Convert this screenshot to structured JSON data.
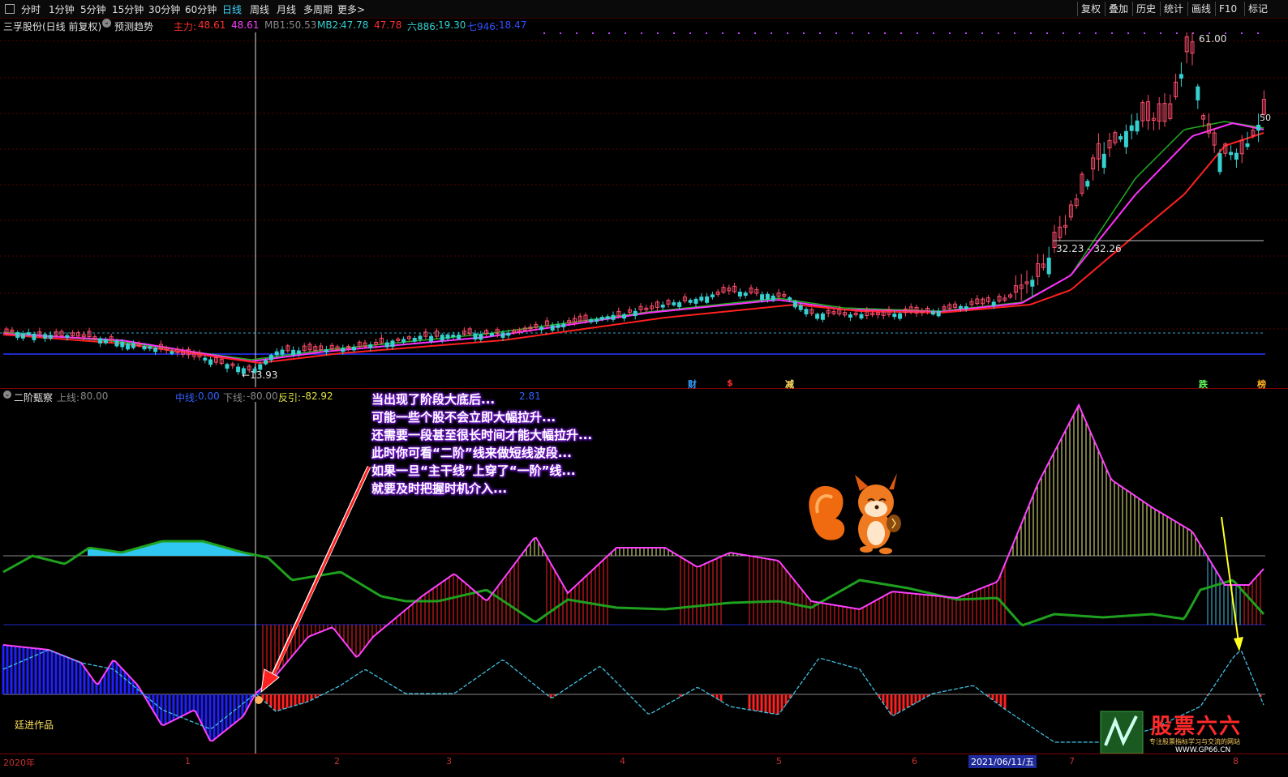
{
  "toolbar": {
    "periods": [
      "分时",
      "1分钟",
      "5分钟",
      "15分钟",
      "30分钟",
      "60分钟",
      "日线",
      "周线",
      "月线",
      "多周期",
      "更多>"
    ],
    "active_period": "日线",
    "right_buttons": [
      "复权",
      "叠加",
      "历史",
      "统计",
      "画线",
      "F10",
      "标记"
    ]
  },
  "main_header": {
    "stock": "三孚股份(日线 前复权)",
    "trend_label": "预测趋势",
    "zhuli_label": "主力:",
    "zhuli_v1": "48.61",
    "zhuli_v2": "48.61",
    "mb1_label": "MB1:",
    "mb1_value": "50.53",
    "mb2_label": "MB2:",
    "mb2_v1": "47.78",
    "mb2_v2": "47.78",
    "six_label": "六886:",
    "six_value": "19.30",
    "seven_label": "七946:",
    "seven_value": "18.47"
  },
  "main_labels": {
    "high_price": "61.00",
    "low_price": "←13.93",
    "range_label": "32.23 - 32.26",
    "right_price": "50"
  },
  "events": [
    "财",
    "$",
    "减",
    "跌",
    "榜"
  ],
  "sub_header": {
    "name": "二阶甄察",
    "upper_label": "上线:",
    "upper_value": "80.00",
    "mid_label": "中线:",
    "mid_value": "0.00",
    "lower_label": "下线:",
    "lower_value": "-80.00",
    "reverse_label": "反引:",
    "reverse_value": "-82.92",
    "extra_value": "2.81"
  },
  "annotation": [
    "当出现了阶段大底后...",
    "可能一些个股不会立即大幅拉升...",
    "还需要一段甚至很长时间才能大幅拉升...",
    "此时你可看“二阶”线来做短线波段...",
    "如果一旦“主干线”上穿了“一阶”线...",
    "就要及时把握时机介入..."
  ],
  "credit": "廷进作品",
  "watermark": {
    "brand": "股票六六",
    "slogan": "专注股票指标学习与交流的网站",
    "url": "WWW.GP66.CN"
  },
  "xaxis": {
    "ticks": [
      "2020年",
      "1",
      "2",
      "3",
      "4",
      "5",
      "6",
      "7",
      "8"
    ],
    "selected_date": "2021/06/11/五"
  },
  "colors": {
    "candle_up": "#ff4d6d",
    "candle_down": "#36d0d0",
    "ma_magenta": "#ff30ff",
    "ma_red": "#ff2020",
    "ma_green": "#20b020",
    "sub_green": "#1fa01f",
    "sub_magenta": "#ff40ff",
    "sub_cyan": "#40c0e0",
    "hist_yellow": "#f0f080",
    "hist_red": "#ff2020",
    "hist_blue": "#2020ff",
    "cyan_fill": "#30c8f0",
    "baseline_blue": "#1e28c8"
  }
}
